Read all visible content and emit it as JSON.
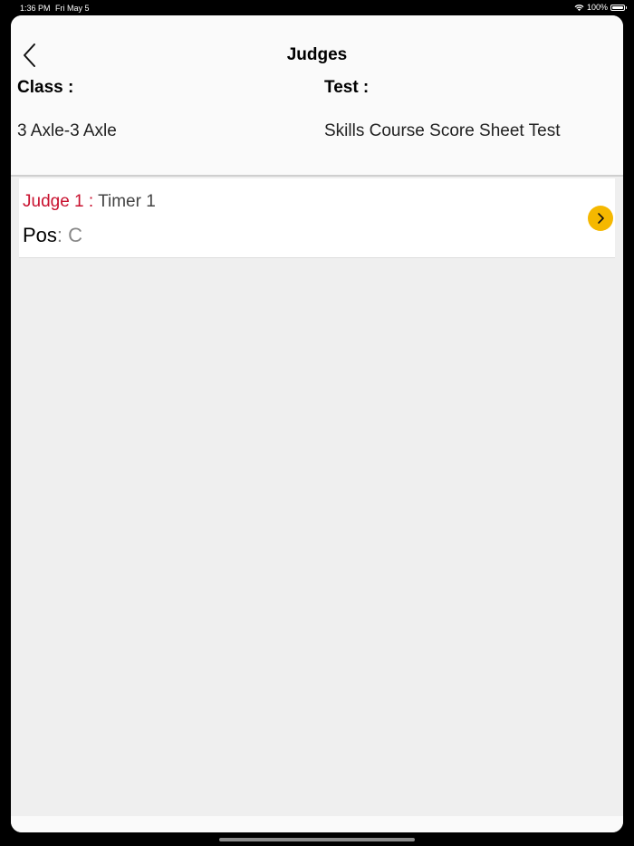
{
  "status_bar": {
    "time": "1:36 PM",
    "date": "Fri May 5",
    "battery": "100%",
    "wifi_icon": "wifi-icon",
    "battery_icon": "battery-icon"
  },
  "nav": {
    "title": "Judges",
    "back_icon": "chevron-left-icon"
  },
  "info": {
    "class_label": "Class :",
    "class_value": "3 Axle-3 Axle",
    "test_label": "Test :",
    "test_value": "Skills Course Score Sheet Test"
  },
  "judges": [
    {
      "judge_label": "Judge 1 :",
      "judge_name": " Timer 1",
      "pos_label": "Pos",
      "pos_sep": ": ",
      "pos_value": "C",
      "action_icon": "chevron-right-icon"
    }
  ],
  "colors": {
    "accent": "#f5b800",
    "judge_label": "#c8102e",
    "background": "#efefef"
  }
}
